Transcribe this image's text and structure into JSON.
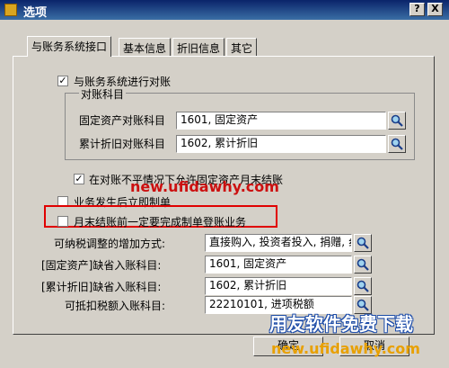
{
  "window": {
    "title": "选项",
    "help_btn": "?",
    "close_btn": "X"
  },
  "tabs": [
    {
      "label": "与账务系统接口"
    },
    {
      "label": "基本信息"
    },
    {
      "label": "折旧信息"
    },
    {
      "label": "其它"
    }
  ],
  "reconcile": {
    "label": "与账务系统进行对账",
    "checked": "✓",
    "group_title": "对账科目",
    "fixed_asset_label": "固定资产对账科目",
    "fixed_asset_value": "1601, 固定资产",
    "depr_label": "累计折旧对账科目",
    "depr_value": "1602, 累计折旧"
  },
  "options": {
    "allow_close_label": "在对账不平情况下允许固定资产月末结账",
    "allow_close_checked": "✓",
    "immediate_voucher_label": "业务发生后立即制单",
    "month_end_label": "月末结账前一定要完成制单登账业务"
  },
  "defaults": {
    "tax_increase_label": "可纳税调整的增加方式:",
    "tax_increase_value": "直接购入, 投资者投入, 捐赠, 纟",
    "fa_default_label": "[固定资产]缺省入账科目:",
    "fa_default_value": "1601, 固定资产",
    "depr_default_label": "[累计折旧]缺省入账科目:",
    "depr_default_value": "1602, 累计折旧",
    "tax_deduct_label": "可抵扣税额入账科目:",
    "tax_deduct_value": "22210101, 进项税额"
  },
  "buttons": {
    "ok": "确定",
    "cancel": "取消"
  },
  "watermarks": {
    "url_red": "new.ufidawhy.com",
    "site_name": "用友软件免费下载",
    "url_orange": "new.ufidawhy.com"
  },
  "colors": {
    "title_bar": "#0a246a",
    "highlight_border": "#e00000",
    "window_bg": "#d4d0c8"
  }
}
